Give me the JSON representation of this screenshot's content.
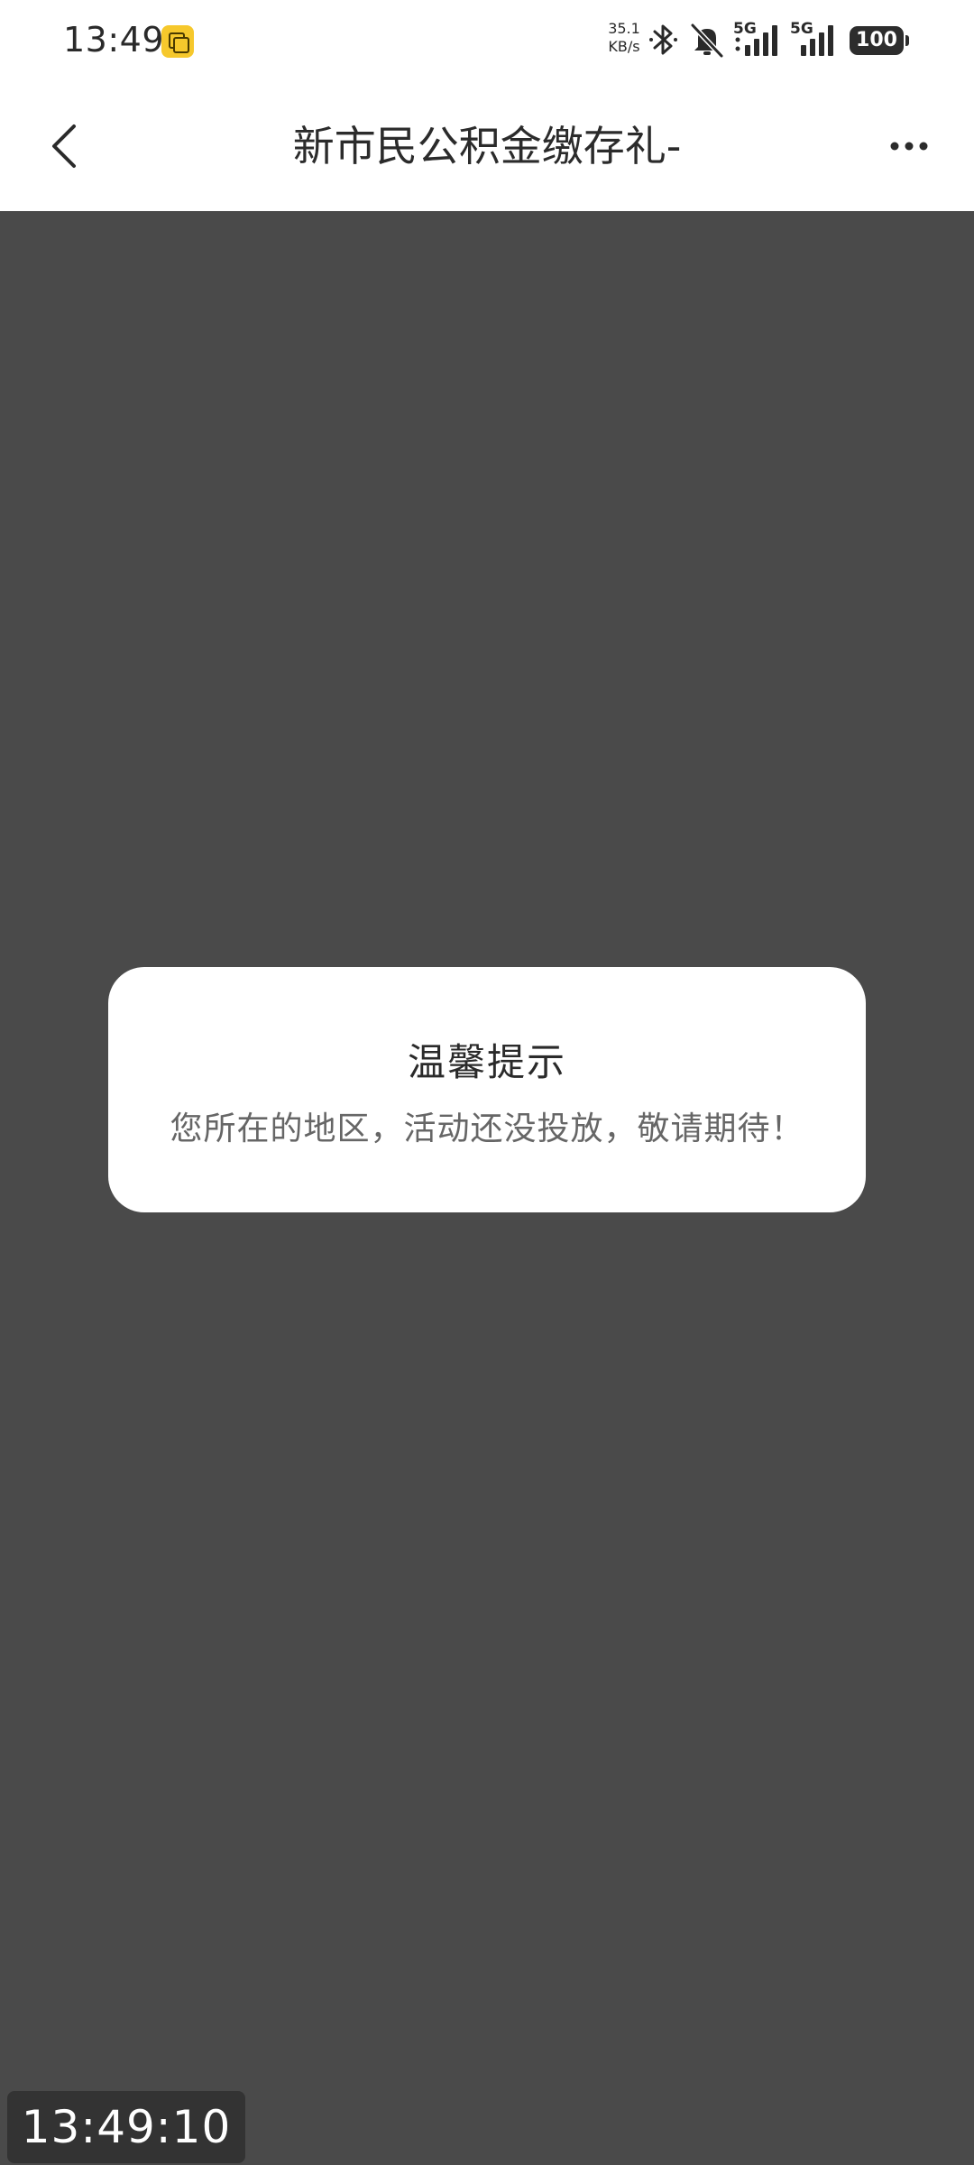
{
  "status_bar": {
    "time": "13:49",
    "net_speed_value": "35.1",
    "net_speed_unit": "KB/s",
    "network_1": "5G",
    "network_2": "5G",
    "battery": "100",
    "icons": [
      "app-badge-icon",
      "bluetooth-icon",
      "mute-icon",
      "signal-icon",
      "signal-icon"
    ]
  },
  "nav": {
    "title": "新市民公积金缴存礼-",
    "back_icon": "chevron-left-icon",
    "more_icon": "more-dots-icon"
  },
  "dialog": {
    "title": "温馨提示",
    "message": "您所在的地区，活动还没投放，敬请期待！"
  },
  "overlay_timer": "13:49:10",
  "colors": {
    "overlay": "#4a4a4a",
    "dialog_bg": "#ffffff",
    "badge": "#f6c82c"
  }
}
